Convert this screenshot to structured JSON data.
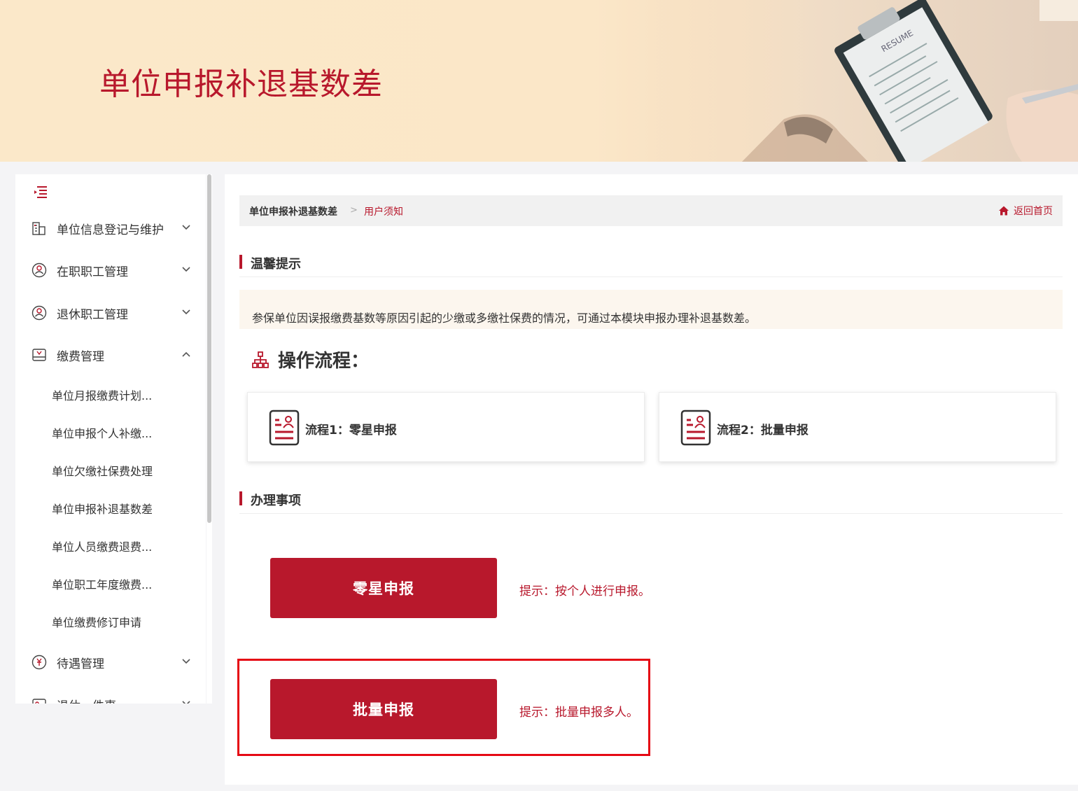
{
  "banner": {
    "title": "单位申报补退基数差",
    "image_text": "RESUME"
  },
  "sidebar": {
    "collapse_icon": "menu-collapse-icon",
    "items": [
      {
        "label": "单位信息登记与维护",
        "icon": "building-icon",
        "expanded": false
      },
      {
        "label": "在职职工管理",
        "icon": "people-icon",
        "expanded": false
      },
      {
        "label": "退休职工管理",
        "icon": "people-icon",
        "expanded": false
      },
      {
        "label": "缴费管理",
        "icon": "payment-icon",
        "expanded": true
      },
      {
        "label": "待遇管理",
        "icon": "benefit-icon",
        "expanded": false
      },
      {
        "label": "退休一件事",
        "icon": "card-icon",
        "expanded": false
      }
    ],
    "sub_items": [
      "单位月报缴费计划...",
      "单位申报个人补缴...",
      "单位欠缴社保费处理",
      "单位申报补退基数差",
      "单位人员缴费退费...",
      "单位职工年度缴费...",
      "单位缴费修订申请"
    ]
  },
  "breadcrumb": {
    "item1": "单位申报补退基数差",
    "separator": ">",
    "item2": "用户须知",
    "home_label": "返回首页"
  },
  "notice": {
    "title": "温馨提示",
    "text": "参保单位因误报缴费基数等原因引起的少缴或多缴社保费的情况，可通过本模块申报办理补退基数差。"
  },
  "process": {
    "title": "操作流程：",
    "steps": [
      {
        "label": "流程1：零星申报"
      },
      {
        "label": "流程2：批量申报"
      }
    ]
  },
  "tasks": {
    "title": "办理事项",
    "items": [
      {
        "button": "零星申报",
        "hint": "提示：按个人进行申报。"
      },
      {
        "button": "批量申报",
        "hint": "提示：批量申报多人。"
      }
    ]
  },
  "colors": {
    "accent": "#b8182c",
    "banner_bg": "#fbe8c9",
    "highlight": "#e50914"
  }
}
